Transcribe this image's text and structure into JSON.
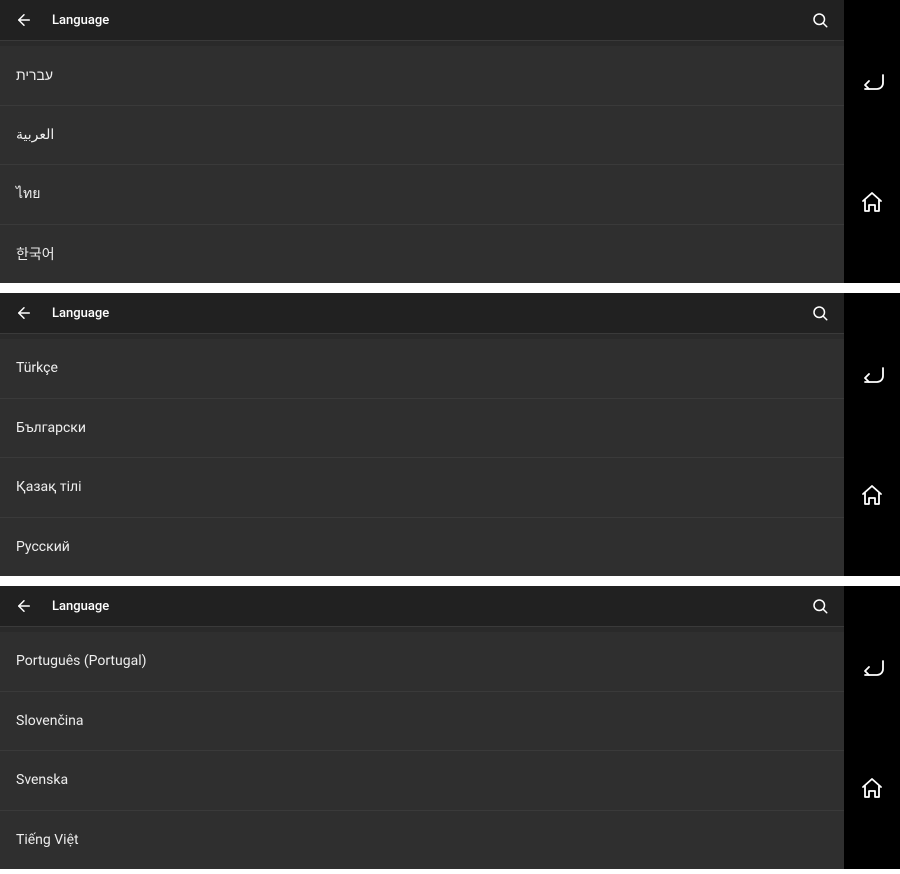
{
  "screens": [
    {
      "header": {
        "title": "Language"
      },
      "items": [
        "עברית",
        "العربية",
        "ไทย",
        "한국어"
      ]
    },
    {
      "header": {
        "title": "Language"
      },
      "items": [
        "Türkçe",
        "Български",
        "Қазақ тілі",
        "Русский"
      ]
    },
    {
      "header": {
        "title": "Language"
      },
      "items": [
        "Português (Portugal)",
        "Slovenčina",
        "Svenska",
        "Tiếng Việt"
      ]
    }
  ]
}
